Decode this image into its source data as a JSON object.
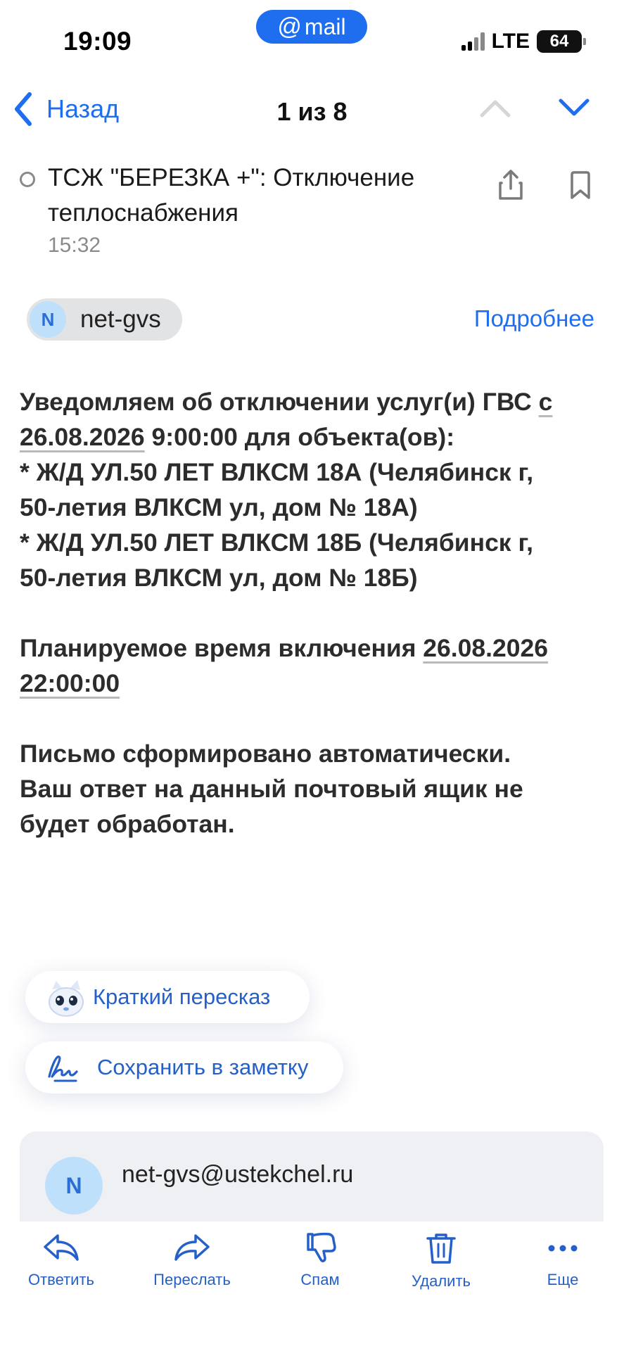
{
  "status_bar": {
    "time": "19:09",
    "app_badge": "mail",
    "network": "LTE",
    "battery": "64"
  },
  "nav": {
    "back_label": "Назад",
    "counter": "1 из 8"
  },
  "email": {
    "subject": "ТСЖ \"БЕРЕЗКА +\": Отключение теплоснабжения",
    "time": "15:32",
    "sender_initial": "N",
    "sender_name": "net-gvs",
    "details_label": "Подробнее",
    "body": {
      "l1a": "Уведомляем об отключении услуг(и) ГВС ",
      "l1b": "с",
      "l2a": "26.08.2026",
      "l2b": " 9:00:00 для объекта(ов):",
      "l3": "* Ж/Д УЛ.50 ЛЕТ ВЛКСМ 18А (Челябинск г,",
      "l4": "50-летия ВЛКСМ ул, дом № 18А)",
      "l5": "* Ж/Д УЛ.50 ЛЕТ ВЛКСМ 18Б (Челябинск г,",
      "l6": "50-летия ВЛКСМ ул, дом № 18Б)",
      "l7a": "Планируемое время включения ",
      "l7b": "26.08.2026",
      "l8": "22:00:00",
      "l9": "Письмо сформировано автоматически.",
      "l10": "Ваш ответ на данный почтовый ящик не",
      "l11": "будет обработан."
    }
  },
  "actions": {
    "summary_label": "Краткий пересказ",
    "note_label": "Сохранить в заметку"
  },
  "sender_card": {
    "initial": "N",
    "email": "net-gvs@ustekchel.ru"
  },
  "toolbar": {
    "reply": "Ответить",
    "forward": "Переслать",
    "spam": "Спам",
    "delete": "Удалить",
    "more": "Еще"
  },
  "colors": {
    "accent": "#1f6ef0",
    "text": "#2c2c2c",
    "muted": "#8a8a8a",
    "chip_bg": "#e2e3e5",
    "avatar_bg": "#bfe0fb"
  }
}
